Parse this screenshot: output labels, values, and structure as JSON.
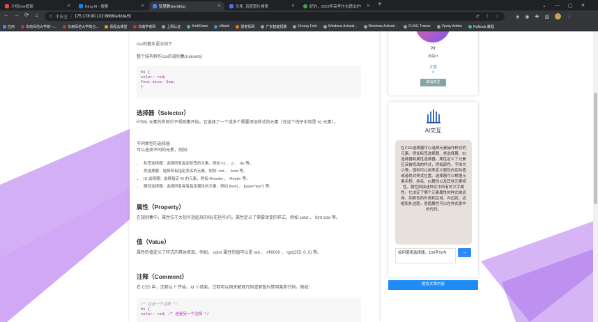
{
  "browser": {
    "tabs": [
      {
        "title": "介绍Vue框架",
        "active": false,
        "color": "#e94b3c"
      },
      {
        "title": "Bing AI - 搜索",
        "active": false,
        "color": "#0a84ff"
      },
      {
        "title": "智慧教GenBlog",
        "active": true,
        "color": "#4285f4"
      },
      {
        "title": "头条_百度图片搜索",
        "active": false,
        "color": "#4e6ef2"
      },
      {
        "title": "好的，2023年高考作文题出炉!",
        "active": false,
        "color": "#34a853"
      }
    ],
    "new_tab": "+",
    "address": {
      "security_label": "不安全",
      "url": "175.178.90.122:8888/article/5/"
    },
    "bookmarks": [
      {
        "label": "应用",
        "color": "#4285f4"
      },
      {
        "label": "华南师范大学统一...",
        "color": "#c0392b"
      },
      {
        "label": "华南师范大学综合...",
        "color": "#c0392b"
      },
      {
        "label": "看程云课堂",
        "color": "#f39c12"
      },
      {
        "label": "华南学者网",
        "color": "#c0392b"
      },
      {
        "label": "上网认证",
        "color": "#9aa0a6"
      },
      {
        "label": "KinhDown",
        "color": "#2ecc71"
      },
      {
        "label": "vWash",
        "color": "#3498db"
      },
      {
        "label": "梁老师网",
        "color": "#e67e22"
      },
      {
        "label": "广东智能招聘",
        "color": "#9aa0a6"
      },
      {
        "label": "Greasy Fork",
        "color": "#9aa0a6"
      },
      {
        "label": "Windows Activati...",
        "color": "#9aa0a6"
      },
      {
        "label": "Windows Activati...",
        "color": "#9aa0a6"
      },
      {
        "label": "FLiNG Trainer",
        "color": "#9aa0a6"
      },
      {
        "label": "Vposy Adobe",
        "color": "#9aa0a6"
      },
      {
        "label": "RuNoob 教程",
        "color": "#2ecc71"
      }
    ]
  },
  "article": {
    "intro": "css的基本语法如下",
    "rulesets": "整个结构称作css的规则集(rulesets)",
    "code1": [
      "h1 {",
      "  color: red;",
      "  font-size: 5em;",
      "}"
    ],
    "selector_heading": "选择器（Selector）",
    "selector_p1": "HTML 元素的名称位于规则集开始。它选择了一个或多个需要添加样式的元素（在这个例子中就是 h1 元素）。",
    "selector_p2a": "不同类型的选择器",
    "selector_p2b": "可以选择不同的元素，例如：",
    "selector_items": [
      "标签选择器：选择所有指定标签的元素，例如 h1 、 p 、 div 等。",
      "类选择器：选择所有指定类名的元素，例如 .red 、 .bold 等。",
      "ID 选择器：选择指定 ID 的元素，例如 #header 、 #footer 等。",
      "属性选择器：选择所有具有指定属性的元素，例如 [href] 、 [type=\"text\"] 等。"
    ],
    "property_heading": "属性（Property）",
    "property_p": "在规则集中，属性位于大括号括起来的块(花括号)内。属性定义了需要改变的样式，例如 color 、 font size 等。",
    "value_heading": "值（Value）",
    "value_p": "属性的值定义了样式的具体表现。例如， color 属性的值可以是 red 、 #ff0000 、 rgb(255, 0, 0) 等。",
    "comment_heading": "注释（Comment）",
    "comment_p": "在 CSS 中，注释以 /* 开始，以 */ 结束。注释可以用来解释代码或者暂时禁用某些代码。例如：",
    "code2": [
      "/* 这是一个注释 */",
      "h1 {",
      "  color: red; /* 这是另一个注释 */"
    ]
  },
  "profile": {
    "name": "Xr",
    "bio": "我是xr",
    "articles_label": "文章",
    "articles_count": "4",
    "follow_button": "取消关注"
  },
  "ai": {
    "title": "AI交互",
    "response": "在CSS选择器可以选择元素操作样式的元素。例如标签选择器、类选择器、ID选择器和属性选择器。属性定义了元素应该被修改的样式，例如颜色、字体大小等。值则可以用来定义属性的实际值或者绝对样式位置。选择器可以根据元素名称、类名、ID属性以及其他元素特性，属性则描述样式中所有的文字属性。它决定了哪个元素属性的样式被运用，如颜色的外观和区域、内边距、边框和外边距。而值属性可以在样式表中的代码。"
  },
  "input": {
    "value": "如何使用选择器，100字以内",
    "send_icon": "→"
  },
  "submit_button": "提炼文章内容"
}
